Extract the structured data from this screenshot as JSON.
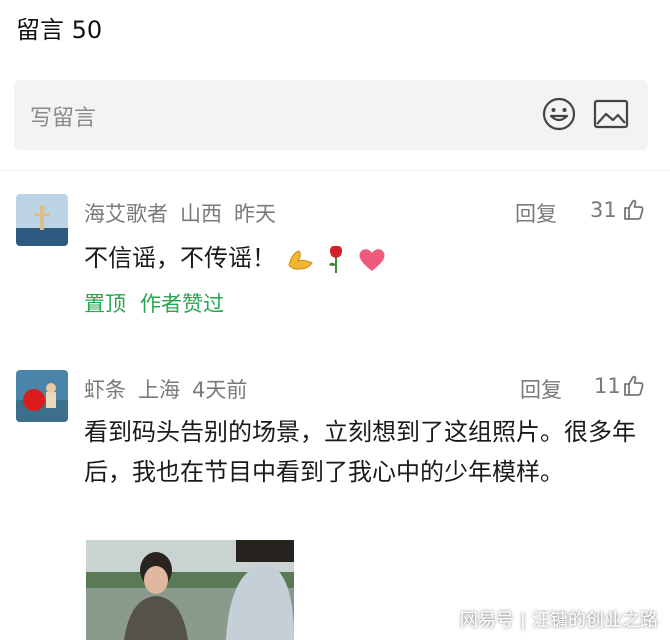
{
  "header": {
    "title": "留言 50"
  },
  "compose": {
    "placeholder": "写留言",
    "emoji_icon": "emoji-smile-icon",
    "image_icon": "image-icon"
  },
  "comments": [
    {
      "name": "海艾歌者",
      "location": "山西",
      "time": "昨天",
      "reply_label": "回复",
      "likes": "31",
      "text": "不信谣，不传谣！",
      "tags": [
        "置顶",
        "作者赞过"
      ]
    },
    {
      "name": "虾条",
      "location": "上海",
      "time": "4天前",
      "reply_label": "回复",
      "likes": "11",
      "text": "看到码头告别的场景，立刻想到了这组照片。很多年后，我也在节目中看到了我心中的少年模样。"
    }
  ],
  "watermark": {
    "brand": "网易号",
    "author": "汪镛的创业之路"
  },
  "colors": {
    "accent_green": "#2aa653",
    "meta_gray": "#7a7a7a",
    "compose_bg": "#f3f3f3"
  }
}
